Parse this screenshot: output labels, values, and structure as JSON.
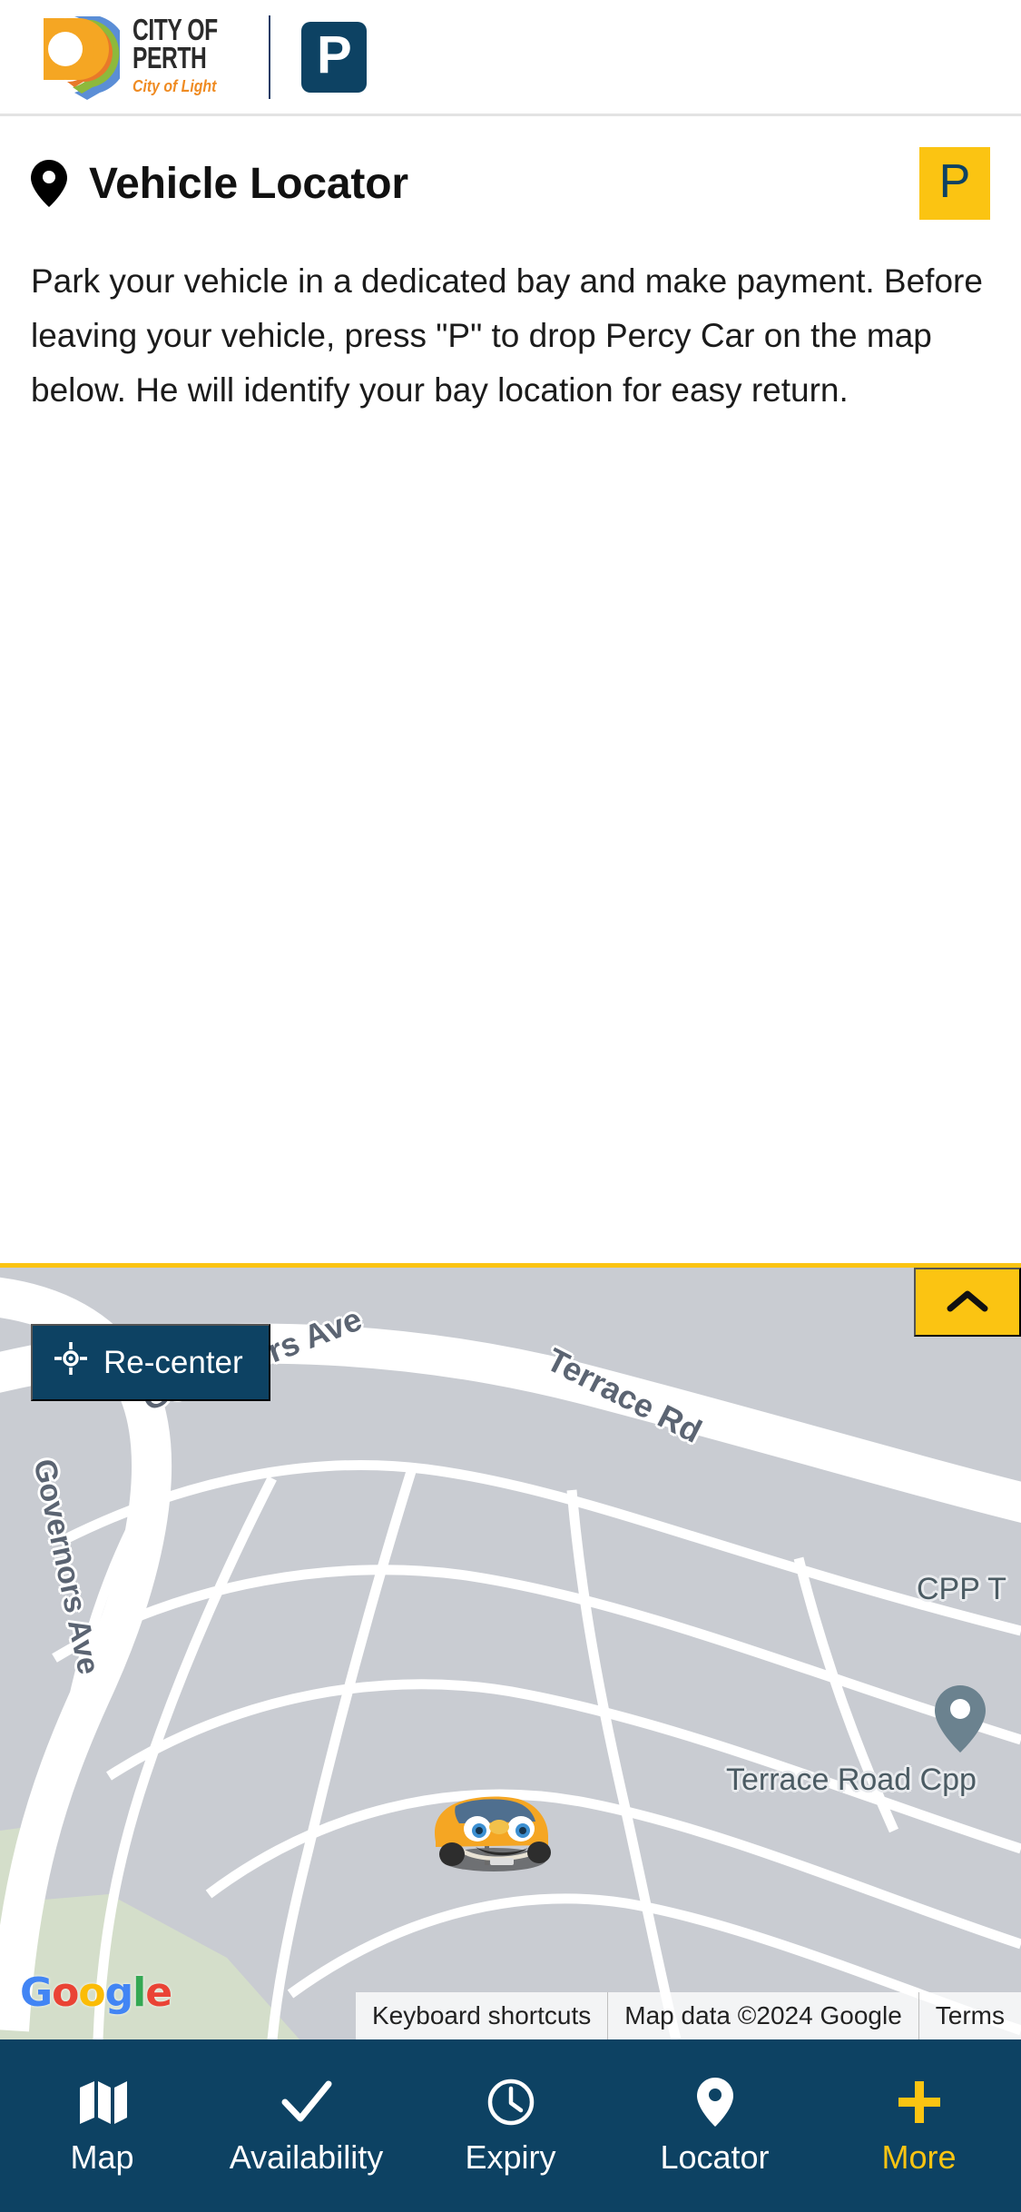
{
  "brand": {
    "logo_line1": "CITY OF",
    "logo_line2": "PERTH",
    "tagline": "City of Light",
    "app_badge_letter": "P"
  },
  "page": {
    "title": "Vehicle Locator",
    "title_icon": "map-pin-icon",
    "badge_letter": "P",
    "description": "Park your vehicle in a dedicated bay and make payment. Before leaving your vehicle, press \"P\" to drop Percy Car on the map below. He will identify your bay location for easy return."
  },
  "map": {
    "recenter_label": "Re-center",
    "recenter_icon": "gps-crosshair-icon",
    "collapse_icon": "chevron-up-icon",
    "vehicle_marker": "percy-car-marker",
    "street_labels": [
      {
        "text": "Governors Ave"
      },
      {
        "text": "Terrace Rd"
      },
      {
        "text": "Governors Ave"
      }
    ],
    "place_labels": [
      {
        "text": "CPP T"
      },
      {
        "text": "Terrace Road Cpp"
      }
    ],
    "google_logo": {
      "g1": "G",
      "o1": "o",
      "o2": "o",
      "g2": "g",
      "l": "l",
      "e": "e"
    },
    "attribution": {
      "keyboard_shortcuts": "Keyboard shortcuts",
      "map_data": "Map data ©2024 Google",
      "terms": "Terms"
    }
  },
  "bottom_nav": {
    "items": [
      {
        "label": "Map",
        "icon": "map-folded-icon",
        "active": false
      },
      {
        "label": "Availability",
        "icon": "check-icon",
        "active": false
      },
      {
        "label": "Expiry",
        "icon": "clock-icon",
        "active": false
      },
      {
        "label": "Locator",
        "icon": "map-pin-icon",
        "active": false
      },
      {
        "label": "More",
        "icon": "plus-icon",
        "active": true
      }
    ]
  },
  "colors": {
    "brand_navy": "#0d4263",
    "brand_yellow": "#fbc412",
    "tagline_orange": "#ef8b22",
    "map_grey": "#c9ccd2"
  }
}
